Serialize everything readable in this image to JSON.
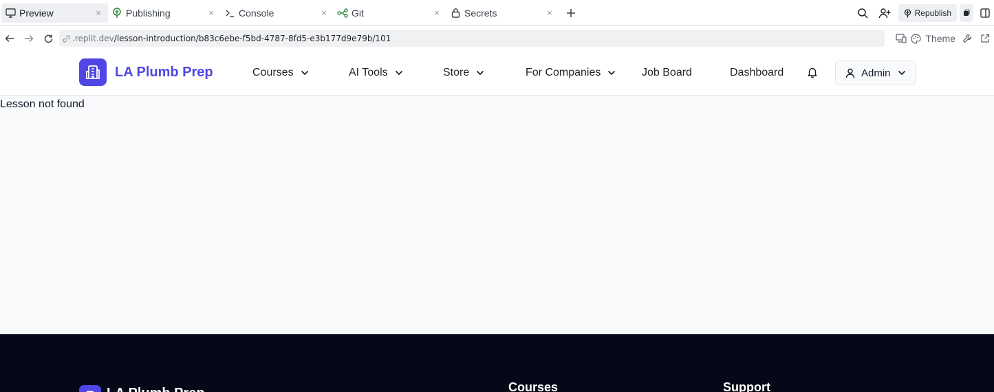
{
  "browser": {
    "tabs": [
      {
        "label": "Preview",
        "icon": "monitor-icon",
        "active": true
      },
      {
        "label": "Publishing",
        "icon": "publish-icon",
        "active": false
      },
      {
        "label": "Console",
        "icon": "terminal-icon",
        "active": false
      },
      {
        "label": "Git",
        "icon": "git-icon",
        "active": false
      },
      {
        "label": "Secrets",
        "icon": "lock-icon",
        "active": false
      }
    ],
    "close_glyph": "×",
    "republish_label": "Republish",
    "url_host": ".replit.dev",
    "url_path": "/lesson-introduction/b83c6ebe-f5bd-4787-8fd5-e3b177d9e79b/101",
    "theme_label": "Theme"
  },
  "header": {
    "brand": "LA Plumb Prep",
    "nav": [
      {
        "label": "Courses",
        "has_dropdown": true
      },
      {
        "label": "AI Tools",
        "has_dropdown": true
      },
      {
        "label": "Store",
        "has_dropdown": true
      },
      {
        "label": "For Companies",
        "has_dropdown": true
      },
      {
        "label": "Job Board",
        "has_dropdown": false
      },
      {
        "label": "Dashboard",
        "has_dropdown": false
      }
    ],
    "user_label": "Admin"
  },
  "main": {
    "message": "Lesson not found"
  },
  "footer": {
    "brand": "LA Plumb Prep",
    "columns": [
      "Courses",
      "Support"
    ]
  },
  "colors": {
    "brand": "#5046e5",
    "footer_bg": "#050816",
    "main_bg": "#f9fafb",
    "publishing_icon": "#2f8a3b",
    "git_icon": "#2f8a3b"
  }
}
